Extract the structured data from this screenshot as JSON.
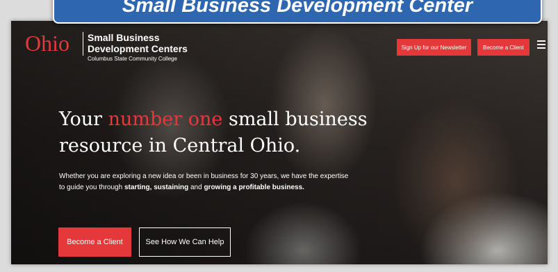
{
  "banner": {
    "title": "Small Business Development Center"
  },
  "header": {
    "logo_word": "Ohio",
    "logo_line1": "Small Business",
    "logo_line2": "Development Centers",
    "logo_sub": "Columbus State Community College",
    "newsletter_button": "Sign Up for our Newsletter",
    "client_button": "Become a Client",
    "menu_icon": "hamburger-icon"
  },
  "hero": {
    "title_pre": "Your ",
    "title_accent": "number one",
    "title_post1": " small business",
    "title_post2": "resource in Central Ohio.",
    "body_line1": "Whether you are exploring a new idea or been in business for 30 years, we have the expertise",
    "body_pre": "to guide you through ",
    "body_b1": "starting, sustaining",
    "body_mid": " and ",
    "body_b2": "growing a profitable business.",
    "cta_primary": "Become a Client",
    "cta_secondary": "See How We Can Help"
  },
  "colors": {
    "brand_red": "#e5383b",
    "banner_blue": "#2f66b0"
  }
}
